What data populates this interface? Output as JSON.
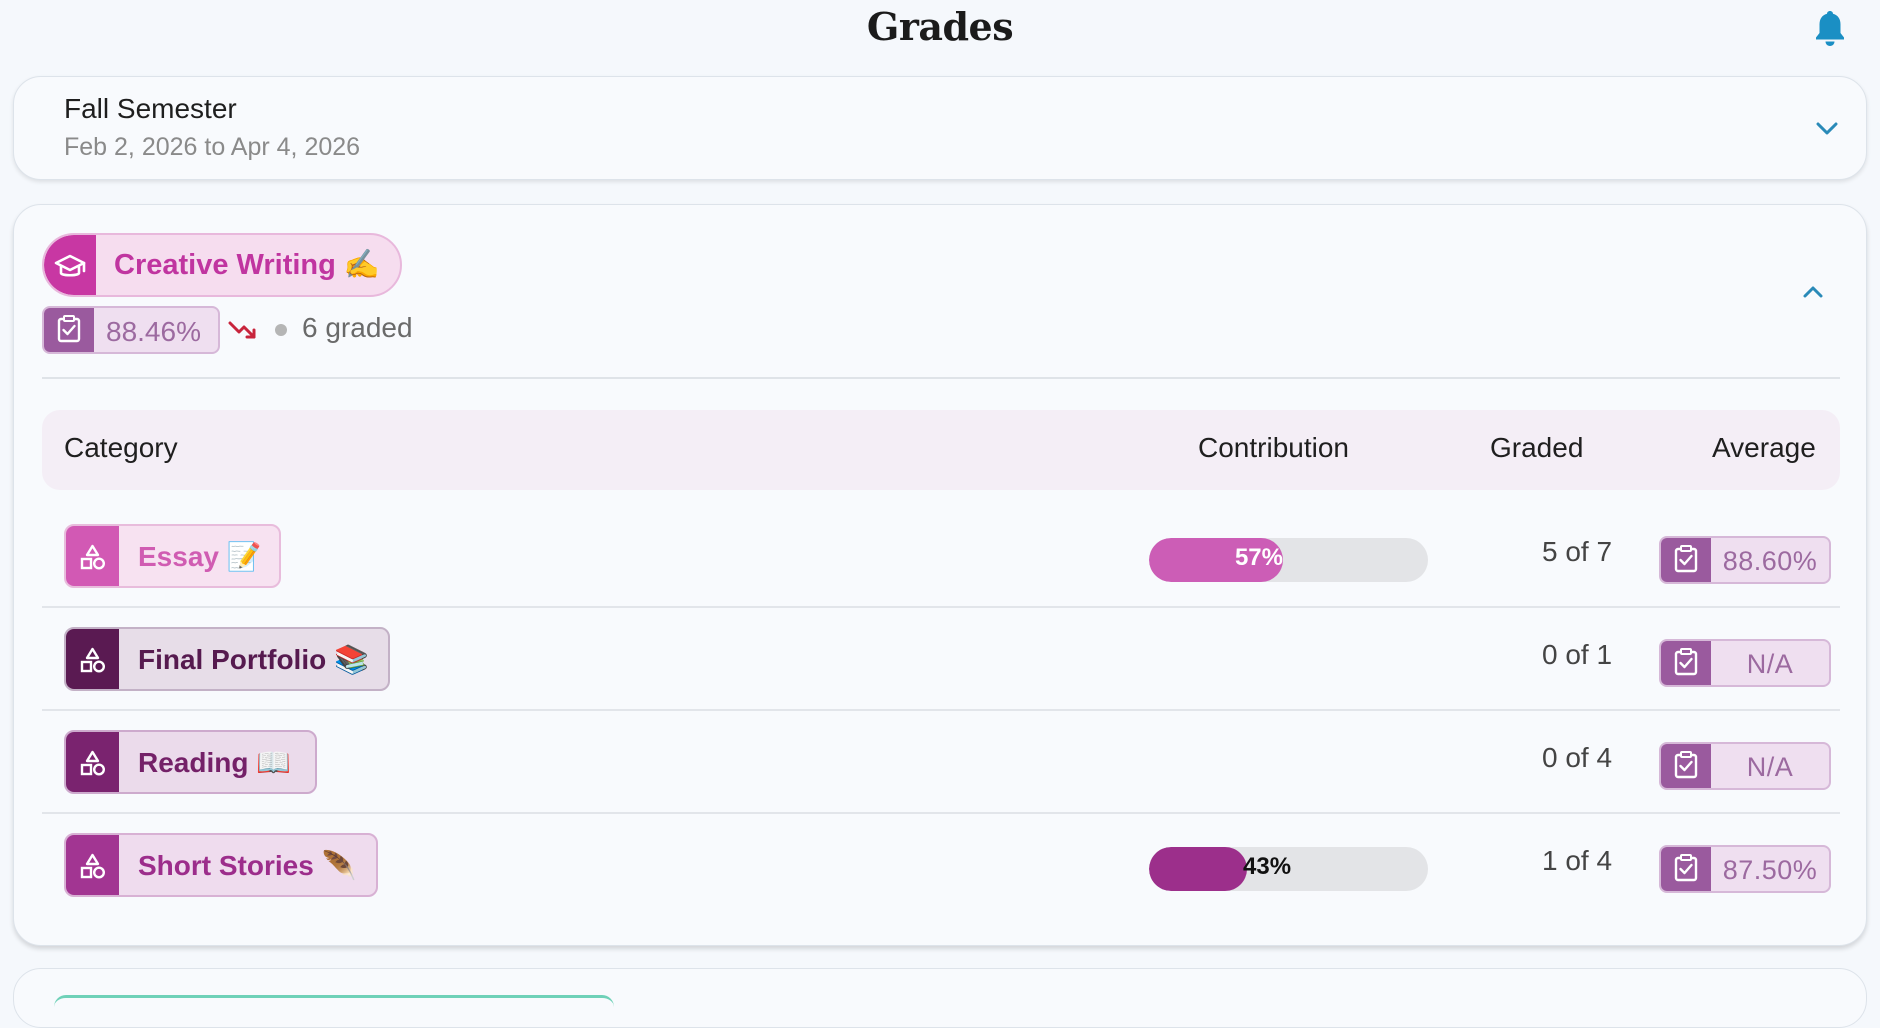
{
  "header": {
    "title": "Grades",
    "bell_icon": "bell-icon"
  },
  "colors": {
    "accent": "#1a8fc4",
    "course_magenta": "#c837a3",
    "badge_purple": "#9a5a9e",
    "trend_red": "#c8243c"
  },
  "semester": {
    "name": "Fall Semester",
    "range": "Feb 2, 2026 to Apr 4, 2026"
  },
  "course": {
    "name": "Creative Writing ✍",
    "average": "88.46%",
    "trend_icon": "trending-down-icon",
    "graded_count": "6 graded"
  },
  "table": {
    "headers": {
      "category": "Category",
      "contribution": "Contribution",
      "graded": "Graded",
      "average": "Average"
    },
    "rows": [
      {
        "category": "Essay 📝",
        "contribution": 57,
        "contribution_label": "57%",
        "graded": "5 of 7",
        "average": "88.60%"
      },
      {
        "category": "Final Portfolio 📚",
        "contribution": null,
        "contribution_label": "",
        "graded": "0 of 1",
        "average": "N/A"
      },
      {
        "category": "Reading 📖",
        "contribution": null,
        "contribution_label": "",
        "graded": "0 of 4",
        "average": "N/A"
      },
      {
        "category": "Short Stories 🪶",
        "contribution": 43,
        "contribution_label": "43%",
        "graded": "1 of 4",
        "average": "87.50%"
      }
    ]
  }
}
